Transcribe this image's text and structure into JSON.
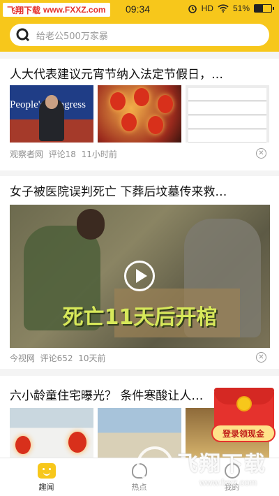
{
  "status_bar": {
    "watermark_name": "飞翔下载",
    "watermark_url": "www.FXXZ.com",
    "time": "09:34",
    "network": "HD",
    "battery": "51%",
    "battery_level": 0.51
  },
  "search": {
    "placeholder": "给老公500万家暴"
  },
  "feed": [
    {
      "title": "人大代表建议元宵节纳入法定节假日，…",
      "source": "观察者网",
      "comments": "评论18",
      "time": "11小时前",
      "thumb1_banner": "People's Congress"
    },
    {
      "title": "女子被医院误判死亡 下葬后坟墓传来救…",
      "source": "今视网",
      "comments": "评论652",
      "time": "10天前",
      "video_caption": "死亡11天后开棺"
    },
    {
      "title": "六小龄童住宅曝光？ 条件寒酸让人…"
    }
  ],
  "promo": {
    "label": "登录领现金"
  },
  "tabs": [
    {
      "label": "趣闻",
      "icon": "fun-face-icon"
    },
    {
      "label": "热点",
      "icon": "hot-icon"
    },
    {
      "label": "我的",
      "icon": "profile-icon"
    }
  ],
  "overlay_watermark": {
    "text": "飞翔下载",
    "url": "www.fxxz.com"
  },
  "colors": {
    "brand_yellow": "#f7c71b",
    "accent_red": "#e5322d"
  }
}
